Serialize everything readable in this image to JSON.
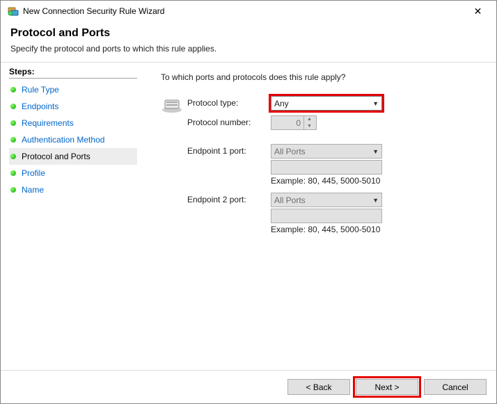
{
  "titlebar": {
    "title": "New Connection Security Rule Wizard"
  },
  "header": {
    "title": "Protocol and Ports",
    "subtitle": "Specify the protocol and ports to which this rule applies."
  },
  "sidebar": {
    "heading": "Steps:",
    "items": [
      {
        "label": "Rule Type",
        "current": false
      },
      {
        "label": "Endpoints",
        "current": false
      },
      {
        "label": "Requirements",
        "current": false
      },
      {
        "label": "Authentication Method",
        "current": false
      },
      {
        "label": "Protocol and Ports",
        "current": true
      },
      {
        "label": "Profile",
        "current": false
      },
      {
        "label": "Name",
        "current": false
      }
    ]
  },
  "main": {
    "prompt": "To which ports and protocols does this rule apply?",
    "protocol_type_label": "Protocol type:",
    "protocol_type_value": "Any",
    "protocol_number_label": "Protocol number:",
    "protocol_number_value": "0",
    "endpoint1_label": "Endpoint 1 port:",
    "endpoint1_value": "All Ports",
    "endpoint1_example": "Example: 80, 445, 5000-5010",
    "endpoint2_label": "Endpoint 2 port:",
    "endpoint2_value": "All Ports",
    "endpoint2_example": "Example: 80, 445, 5000-5010"
  },
  "footer": {
    "back": "< Back",
    "next": "Next >",
    "cancel": "Cancel"
  }
}
